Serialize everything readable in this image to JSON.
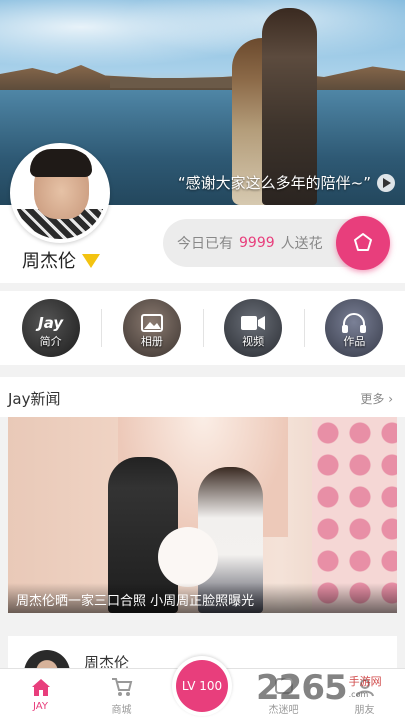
{
  "hero": {
    "quote": "“感谢大家这么多年的陪伴~”"
  },
  "profile": {
    "name": "周杰伦"
  },
  "flower": {
    "prefix": "今日已有",
    "count": "9999",
    "suffix": "人送花"
  },
  "menu": [
    {
      "label": "简介",
      "icon": "jay-logo-icon"
    },
    {
      "label": "相册",
      "icon": "photo-icon"
    },
    {
      "label": "视频",
      "icon": "video-icon"
    },
    {
      "label": "作品",
      "icon": "headphones-icon"
    }
  ],
  "jay_logo": "Jay",
  "news": {
    "title": "Jay新闻",
    "more": "更多",
    "caption": "周杰伦晒一家三口合照 小周周正脸照曝光"
  },
  "post": {
    "name": "周杰伦"
  },
  "tabs": [
    {
      "label": "JAY",
      "icon": "home-icon"
    },
    {
      "label": "商城",
      "icon": "cart-icon"
    },
    {
      "label": "杰迷吧",
      "icon": "forum-icon"
    },
    {
      "label": "朋友",
      "icon": "friends-icon"
    }
  ],
  "level": "LV 100",
  "watermark": {
    "number": "2265",
    "com": ".com",
    "tag": "手游网"
  },
  "colors": {
    "accent": "#e83e7c",
    "badge": "#f3c311"
  }
}
